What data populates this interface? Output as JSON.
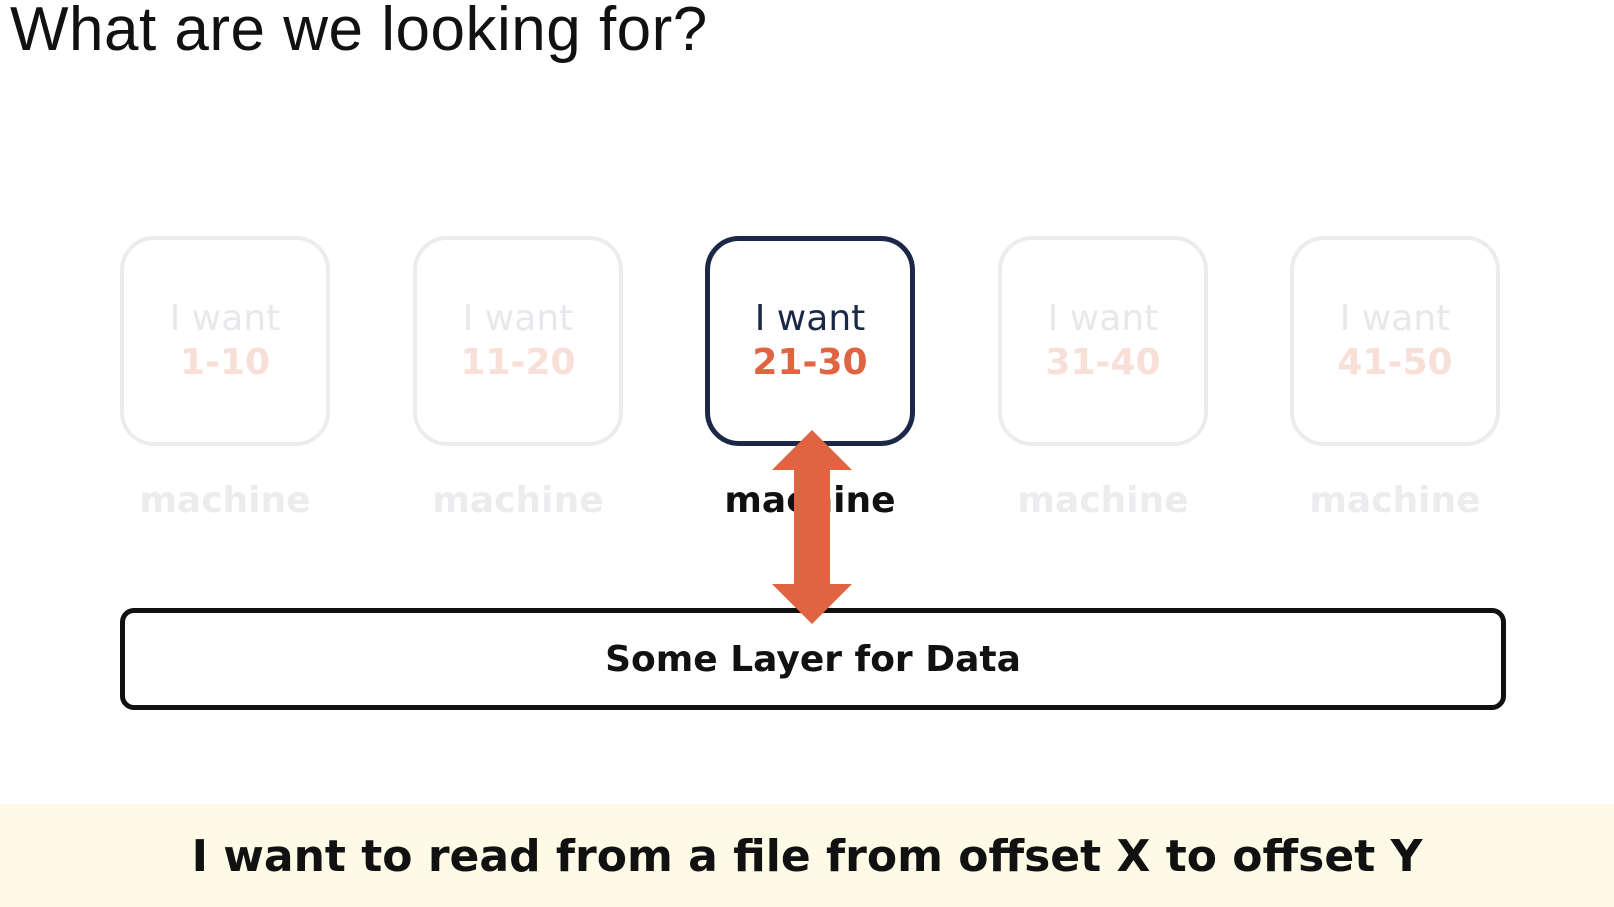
{
  "title": "What are we looking for?",
  "machines": [
    {
      "want": "I want",
      "range": "1-10",
      "label": "machine",
      "active": false
    },
    {
      "want": "I want",
      "range": "11-20",
      "label": "machine",
      "active": false
    },
    {
      "want": "I want",
      "range": "21-30",
      "label": "machine",
      "active": true
    },
    {
      "want": "I want",
      "range": "31-40",
      "label": "machine",
      "active": false
    },
    {
      "want": "I want",
      "range": "41-50",
      "label": "machine",
      "active": false
    }
  ],
  "data_layer": {
    "label": "Some Layer for Data"
  },
  "caption": "I want to read from a file from offset X to offset Y",
  "icons": {
    "connector": "double-arrow-vertical-icon"
  },
  "colors": {
    "accent": "#e06342",
    "active_border": "#1b2847",
    "inactive_border": "#ececef",
    "caption_band": "#fdfbe6"
  }
}
